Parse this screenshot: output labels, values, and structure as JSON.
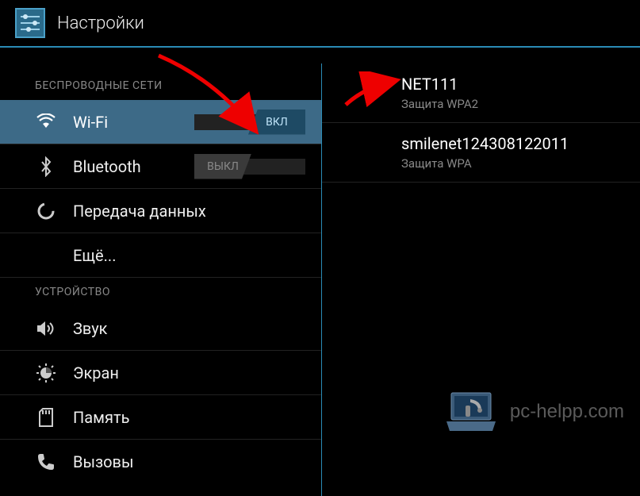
{
  "header": {
    "title": "Настройки"
  },
  "sections": {
    "wireless": "БЕСПРОВОДНЫЕ СЕТИ",
    "device": "УСТРОЙСТВО"
  },
  "sidebar": {
    "wifi": {
      "label": "Wi-Fi",
      "toggle": "ВКЛ"
    },
    "bluetooth": {
      "label": "Bluetooth",
      "toggle": "ВЫКЛ"
    },
    "data": {
      "label": "Передача данных"
    },
    "more": {
      "label": "Ещё..."
    },
    "sound": {
      "label": "Звук"
    },
    "display": {
      "label": "Экран"
    },
    "storage": {
      "label": "Память"
    },
    "calls": {
      "label": "Вызовы"
    }
  },
  "networks": [
    {
      "name": "NET111",
      "security": "Защита WPA2"
    },
    {
      "name": "smilenet124308122011",
      "security": "Защита WPA"
    }
  ],
  "watermark": "pc-helpp.com"
}
